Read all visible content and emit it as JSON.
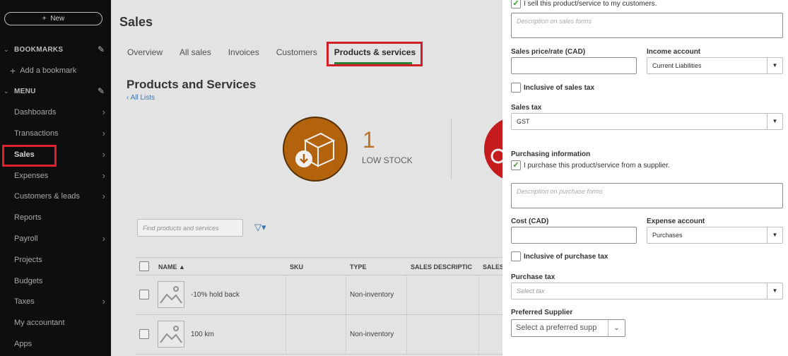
{
  "sidebar": {
    "new_label": "New",
    "bookmarks_label": "BOOKMARKS",
    "add_bookmark": "Add a bookmark",
    "menu_label": "MENU",
    "items": [
      {
        "label": "Dashboards",
        "arrow": true
      },
      {
        "label": "Transactions",
        "arrow": true
      },
      {
        "label": "Sales",
        "arrow": true
      },
      {
        "label": "Expenses",
        "arrow": true
      },
      {
        "label": "Customers & leads",
        "arrow": true
      },
      {
        "label": "Reports",
        "arrow": false
      },
      {
        "label": "Payroll",
        "arrow": true
      },
      {
        "label": "Projects",
        "arrow": false
      },
      {
        "label": "Budgets",
        "arrow": false
      },
      {
        "label": "Taxes",
        "arrow": true
      },
      {
        "label": "My accountant",
        "arrow": false
      },
      {
        "label": "Apps",
        "arrow": false
      }
    ]
  },
  "main": {
    "title": "Sales",
    "tabs": [
      "Overview",
      "All sales",
      "Invoices",
      "Customers",
      "Products & services"
    ],
    "subtitle": "Products and Services",
    "all_lists": "All Lists",
    "low_stock_count": "1",
    "low_stock_label": "LOW STOCK",
    "search_placeholder": "Find products and services",
    "columns": [
      "NAME ▲",
      "SKU",
      "TYPE",
      "SALES DESCRIPTIC",
      "SALES"
    ],
    "rows": [
      {
        "name": "-10% hold back",
        "type": "Non-inventory"
      },
      {
        "name": "100 km",
        "type": "Non-inventory"
      }
    ]
  },
  "panel": {
    "sell_checkbox_label": "I sell this product/service to my customers.",
    "sales_desc_placeholder": "Description on sales forms",
    "sales_price_label": "Sales price/rate (CAD)",
    "income_account_label": "Income account",
    "income_account_value": "Current Liabilities",
    "inclusive_sales_tax": "Inclusive of sales tax",
    "sales_tax_label": "Sales tax",
    "sales_tax_value": "GST",
    "purchasing_info_label": "Purchasing information",
    "purchase_checkbox_label": "I purchase this product/service from a supplier.",
    "purchase_desc_placeholder": "Description on purchase forms",
    "cost_label": "Cost (CAD)",
    "expense_account_label": "Expense account",
    "expense_account_value": "Purchases",
    "inclusive_purchase_tax": "Inclusive of purchase tax",
    "purchase_tax_label": "Purchase tax",
    "purchase_tax_placeholder": "Select tax",
    "preferred_supplier_label": "Preferred Supplier",
    "preferred_supplier_placeholder": "Select a preferred supp"
  },
  "colors": {
    "highlight": "#e0202a",
    "accent_green": "#2ca01c",
    "link_blue": "#3d7bbf",
    "low_stock_orange": "#c06a0e"
  }
}
